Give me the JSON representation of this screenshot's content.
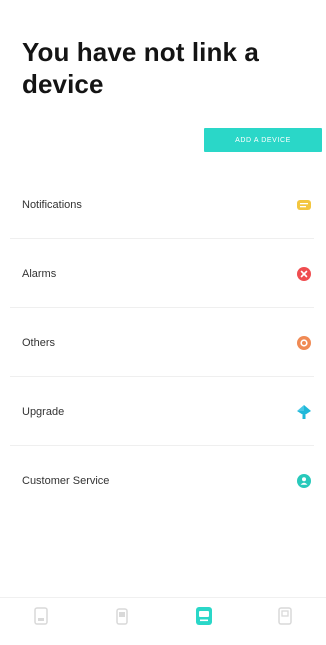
{
  "header": {
    "title": "You have not link a device"
  },
  "add_device": {
    "label": "ADD A DEVICE"
  },
  "menu": {
    "items": [
      {
        "label": "Notifications",
        "icon": "message-icon",
        "color": "#f3c63f"
      },
      {
        "label": "Alarms",
        "icon": "alarm-icon",
        "color": "#ef4d50"
      },
      {
        "label": "Others",
        "icon": "circle-icon",
        "color": "#f08a54"
      },
      {
        "label": "Upgrade",
        "icon": "upgrade-icon",
        "color": "#1fb8d9"
      },
      {
        "label": "Customer Service",
        "icon": "support-icon",
        "color": "#28c9bb"
      }
    ]
  },
  "bottom_nav": {
    "items": [
      {
        "icon": "home-icon",
        "active": false
      },
      {
        "icon": "device-icon",
        "active": false
      },
      {
        "icon": "message-icon",
        "active": true
      },
      {
        "icon": "profile-icon",
        "active": false
      }
    ],
    "active_color": "#2ad7c8",
    "inactive_color": "#d9d9d9"
  }
}
